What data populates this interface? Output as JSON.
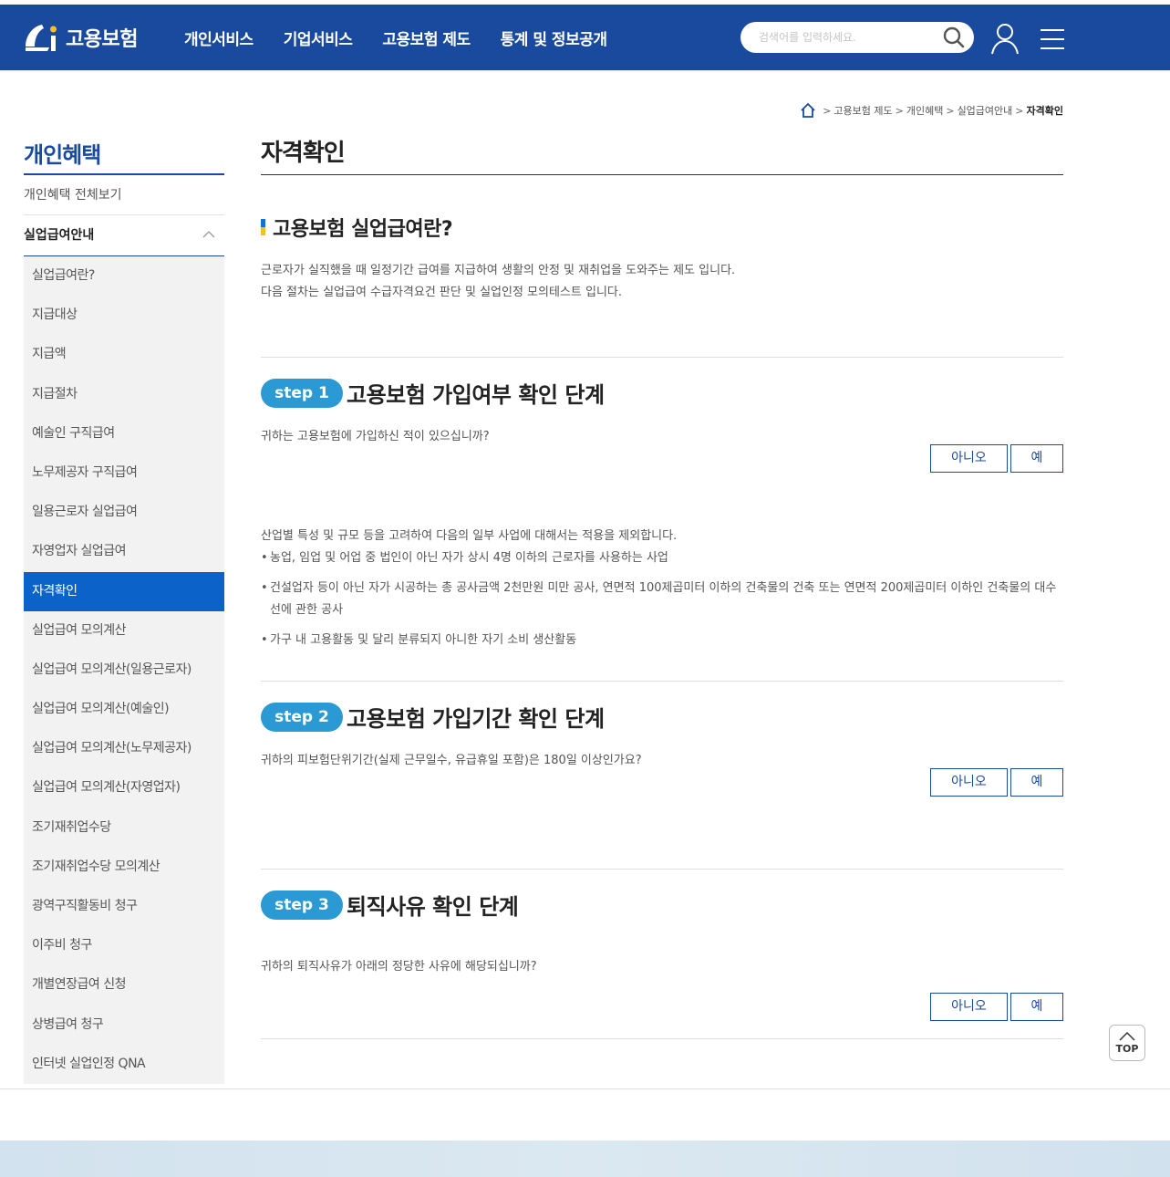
{
  "header": {
    "logo_text": "고용보험",
    "nav": [
      "개인서비스",
      "기업서비스",
      "고용보험 제도",
      "통계 및 정보공개"
    ],
    "search_placeholder": "검색어를 입력하세요."
  },
  "breadcrumb": [
    "고용보험 제도",
    "개인혜택",
    "실업급여안내",
    "자격확인"
  ],
  "sidebar": {
    "title": "개인혜택",
    "all_link": "개인혜택 전체보기",
    "group": "실업급여안내",
    "items": [
      "실업급여란?",
      "지급대상",
      "지급액",
      "지급절차",
      "예술인 구직급여",
      "노무제공자 구직급여",
      "일용근로자 실업급여",
      "자영업자 실업급여",
      "자격확인",
      "실업급여 모의계산",
      "실업급여 모의계산(일용근로자)",
      "실업급여 모의계산(예술인)",
      "실업급여 모의계산(노무제공자)",
      "실업급여 모의계산(자영업자)",
      "조기재취업수당",
      "조기재취업수당 모의계산",
      "광역구직활동비 청구",
      "이주비 청구",
      "개별연장급여 신청",
      "상병급여 청구",
      "인터넷 실업인정 QNA"
    ],
    "active_item": "자격확인"
  },
  "content": {
    "page_title": "자격확인",
    "section_title": "고용보험 실업급여란?",
    "intro_lines": [
      "근로자가 실직했을 때 일정기간 급여를 지급하여 생활의 안정 및 재취업을 도와주는 제도 입니다.",
      "다음 절차는 실업급여 수급자격요건 판단 및 실업인정 모의테스트 입니다."
    ],
    "steps": [
      {
        "badge": "step 1",
        "title": "고용보험 가입여부 확인 단계",
        "question": "귀하는 고용보험에 가입하신 적이 있으십니까?",
        "no_label": "아니오",
        "yes_label": "예"
      },
      {
        "badge": "step 2",
        "title": "고용보험 가입기간 확인 단계",
        "question": "귀하의 피보험단위기간(실제 근무일수, 유급휴일 포함)은 180일 이상인가요?",
        "no_label": "아니오",
        "yes_label": "예"
      },
      {
        "badge": "step 3",
        "title": "퇴직사유 확인 단계",
        "question": "귀하의 퇴직사유가 아래의 정당한 사유에 해당되십니까?",
        "no_label": "아니오",
        "yes_label": "예"
      }
    ],
    "note": {
      "lead": "산업별 특성 및 규모 등을 고려하여 다음의 일부 사업에 대해서는 적용을 제외합니다.",
      "bullets": [
        "농업, 임업 및 어업 중 법인이 아닌 자가 상시 4명 이하의 근로자를 사용하는 사업",
        "건설업자 등이 아닌 자가 시공하는 총 공사금액 2천만원 미만 공사, 연면적 100제곱미터 이하의 건축물의 건축 또는 연면적 200제곱미터 이하인 건축물의 대수선에 관한 공사",
        "가구 내 고용활동 및 달리 분류되지 아니한 자기 소비 생산활동"
      ]
    }
  },
  "top_button": "TOP",
  "colors": {
    "header_bg": "#1a4a9e",
    "active_item_bg": "#0b63c9",
    "step_badge": "#2b9ad4"
  },
  "icons": [
    "logo-icon",
    "search-icon",
    "user-icon",
    "menu-icon",
    "home-icon",
    "chevron-up-icon",
    "arrow-up-icon"
  ]
}
